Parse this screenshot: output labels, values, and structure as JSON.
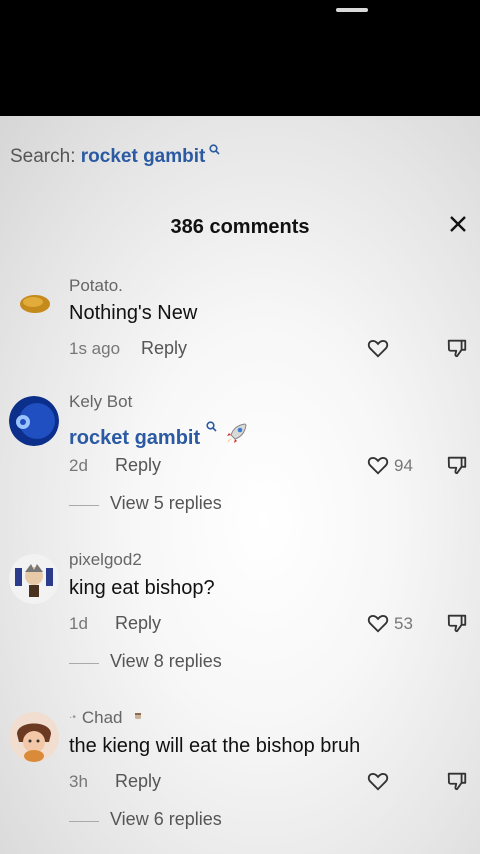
{
  "search": {
    "prefix": "Search:",
    "term": "rocket gambit",
    "icon": "search-icon"
  },
  "header": {
    "comment_count": "386 comments",
    "close_icon": "close-icon"
  },
  "comments": [
    {
      "user": "Potato.",
      "text": "Nothing's New",
      "time": "1s ago",
      "reply": "Reply",
      "likes": "",
      "view_replies": ""
    },
    {
      "user": "Kely Bot",
      "text": "rocket gambit",
      "time": "2d",
      "reply": "Reply",
      "likes": "94",
      "view_replies": "View 5 replies"
    },
    {
      "user": "pixelgod2",
      "text": "king eat bishop?",
      "time": "1d",
      "reply": "Reply",
      "likes": "53",
      "view_replies": "View 8 replies"
    },
    {
      "user": "Chad",
      "text": "the kieng will eat the bishop bruh",
      "time": "3h",
      "reply": "Reply",
      "likes": "",
      "view_replies": "View 6 replies"
    }
  ],
  "colors": {
    "link": "#2b5aa3",
    "text": "#111111",
    "muted": "#777777"
  }
}
